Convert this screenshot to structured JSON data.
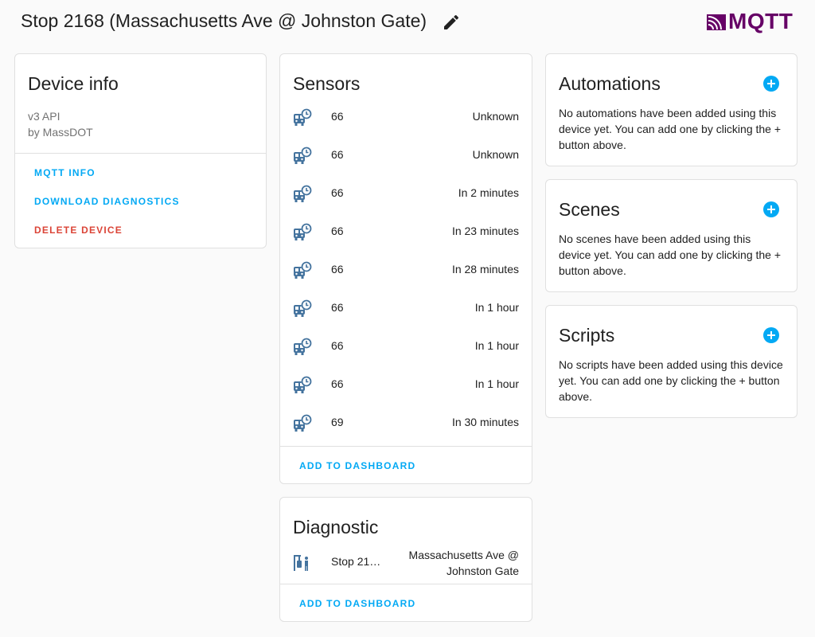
{
  "header": {
    "title": "Stop 2168 (Massachusetts Ave @ Johnston Gate)",
    "edit_icon": "pencil-icon",
    "brand": "MQTT",
    "brand_color": "#660066"
  },
  "device_info": {
    "title": "Device info",
    "model": "v3 API",
    "manufacturer": "by MassDOT",
    "actions": [
      "MQTT INFO",
      "DOWNLOAD DIAGNOSTICS",
      "DELETE DEVICE"
    ]
  },
  "sensors": {
    "title": "Sensors",
    "icon": "bus-clock-icon",
    "items": [
      {
        "name": "66",
        "state": "Unknown"
      },
      {
        "name": "66",
        "state": "Unknown"
      },
      {
        "name": "66",
        "state": "In 2 minutes"
      },
      {
        "name": "66",
        "state": "In 23 minutes"
      },
      {
        "name": "66",
        "state": "In 28 minutes"
      },
      {
        "name": "66",
        "state": "In 1 hour"
      },
      {
        "name": "66",
        "state": "In 1 hour"
      },
      {
        "name": "66",
        "state": "In 1 hour"
      },
      {
        "name": "69",
        "state": "In 30 minutes"
      }
    ],
    "add_label": "ADD TO DASHBOARD"
  },
  "diagnostic": {
    "title": "Diagnostic",
    "icon": "bus-stop-icon",
    "name": "Stop 21…",
    "state_line1": "Massachusetts Ave @",
    "state_line2": "Johnston Gate",
    "add_label": "ADD TO DASHBOARD"
  },
  "automations": {
    "title": "Automations",
    "text": "No automations have been added using this device yet. You can add one by clicking the + button above."
  },
  "scenes": {
    "title": "Scenes",
    "text": "No scenes have been added using this device yet. You can add one by clicking the + button above."
  },
  "scripts": {
    "title": "Scripts",
    "text": "No scripts have been added using this device yet. You can add one by clicking the + button above."
  },
  "colors": {
    "accent": "#03a9f4",
    "danger": "#db4437",
    "icon": "#44739e"
  }
}
